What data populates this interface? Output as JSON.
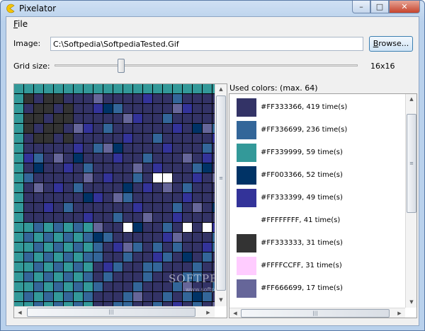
{
  "window": {
    "title": "Pixelator",
    "minimize_glyph": "–",
    "maximize_glyph": "□",
    "close_glyph": "✕"
  },
  "menu": {
    "file_accesskey": "F",
    "file_rest": "ile"
  },
  "image": {
    "label": "Image:",
    "path": "C:\\Softpedia\\SoftpediaTested.Gif",
    "browse_accesskey": "B",
    "browse_rest": "rowse..."
  },
  "grid": {
    "label": "Grid size:",
    "value_text": "16x16",
    "slider_fraction": 0.22
  },
  "used_colors": {
    "label": "Used colors: (max. 64)",
    "items": [
      {
        "hex": "#333366",
        "text": "#FF333366, 419 time(s)"
      },
      {
        "hex": "#336699",
        "text": "#FF336699, 236 time(s)"
      },
      {
        "hex": "#339999",
        "text": "#FF339999, 59 time(s)"
      },
      {
        "hex": "#003366",
        "text": "#FF003366, 52 time(s)"
      },
      {
        "hex": "#333399",
        "text": "#FF333399, 49 time(s)"
      },
      {
        "hex": "#FFFFFF",
        "text": "#FFFFFFFF, 41 time(s)"
      },
      {
        "hex": "#333333",
        "text": "#FF333333, 31 time(s)"
      },
      {
        "hex": "#FFCCFF",
        "text": "#FFFFCCFF, 31 time(s)"
      },
      {
        "hex": "#666699",
        "text": "#FF666699, 17 time(s)"
      }
    ]
  },
  "watermark": {
    "brand": "SOFTPEDIA",
    "url": "www.softpedia.com"
  },
  "scroll_icons": {
    "up": "▲",
    "down": "▼",
    "left": "◀",
    "right": "▶",
    "grip_v": "≡",
    "grip_h": "|||"
  }
}
